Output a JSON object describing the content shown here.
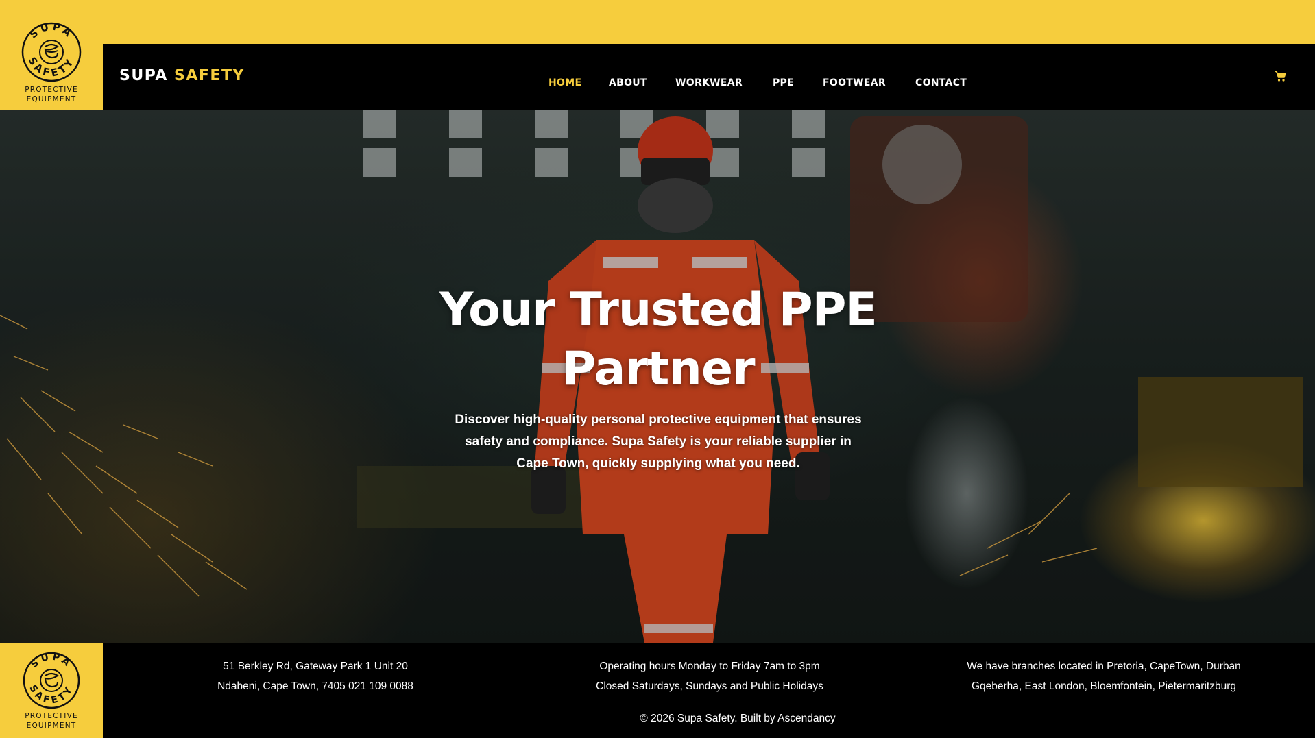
{
  "brand": {
    "name_primary": "SUPA",
    "name_accent": "SAFETY",
    "logo_text_top": "SUPA",
    "logo_text_bottom": "SAFETY",
    "logo_caption_1": "PROTECTIVE",
    "logo_caption_2": "EQUIPMENT"
  },
  "nav": {
    "items": [
      {
        "label": "HOME",
        "active": true
      },
      {
        "label": "ABOUT"
      },
      {
        "label": "WORKWEAR"
      },
      {
        "label": "PPE"
      },
      {
        "label": "FOOTWEAR"
      },
      {
        "label": "CONTACT"
      }
    ],
    "cart_icon": "shopping-cart-icon"
  },
  "hero": {
    "title_line_1": "Your Trusted PPE",
    "title_line_2": "Partner",
    "text_line_1": "Discover high-quality personal protective equipment that ensures",
    "text_line_2": "safety and compliance. Supa Safety is your reliable supplier in",
    "text_line_3": "Cape Town, quickly supplying what you need."
  },
  "footer": {
    "address_line_1": "51 Berkley Rd, Gateway Park 1 Unit 20",
    "address_line_2": "Ndabeni, Cape Town, 7405  021 109 0088",
    "hours_line_1": "Operating hours Monday to Friday 7am to 3pm",
    "hours_line_2": "Closed Saturdays, Sundays and Public Holidays",
    "branches_line_1": "We have branches located in Pretoria, CapeTown, Durban",
    "branches_line_2": "Gqeberha, East London, Bloemfontein, Pietermaritzburg",
    "copyright": "© 2026  Supa Safety. Built by Ascendancy"
  },
  "colors": {
    "accent": "#f6cd3d",
    "background": "#000000",
    "text": "#ffffff"
  }
}
